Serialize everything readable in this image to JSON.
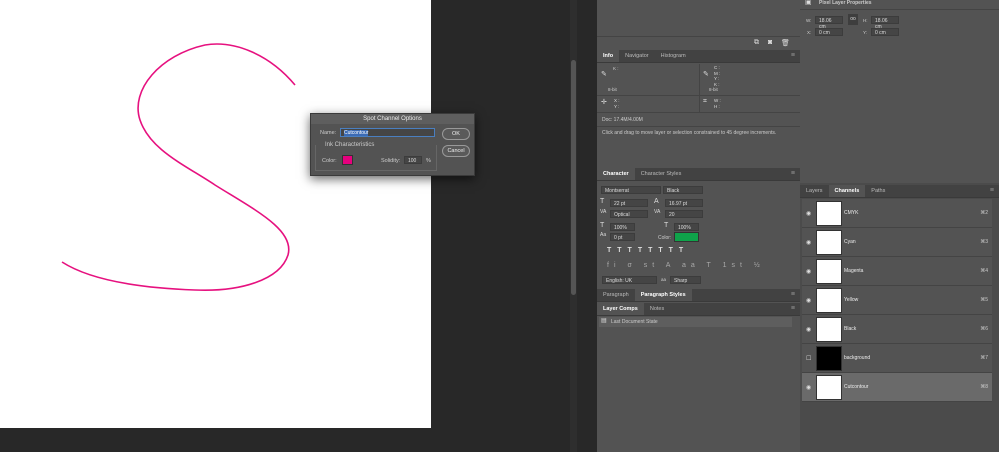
{
  "canvas": {
    "stroke_color": "#e6117f"
  },
  "dialog": {
    "title": "Spot Channel Options",
    "name_label": "Name:",
    "name_value": "Cutcontour",
    "ok": "OK",
    "cancel": "Cancel",
    "ink_label": "Ink Characteristics",
    "color_label": "Color:",
    "color": "#e6007e",
    "solidity_label": "Solidity:",
    "solidity_value": "100",
    "percent": "%"
  },
  "info": {
    "tabs": [
      "Info",
      "Navigator",
      "Histogram"
    ],
    "k": "K :",
    "cmyk": [
      "C :",
      "M :",
      "Y :",
      "K :"
    ],
    "bit1": "8-bit",
    "bit2": "8-bit",
    "xy": [
      "X :",
      "Y :"
    ],
    "wh": [
      "W :",
      "H :"
    ],
    "doc": "Doc: 17.4M/4.00M",
    "hint": "Click and drag to move layer or selection constrained to 45 degree increments."
  },
  "character": {
    "tabs": [
      "Character",
      "Character Styles"
    ],
    "font": "Montserrat",
    "style": "Black",
    "size": "22 pt",
    "leading": "16.97 pt",
    "kerning": "Optical",
    "tracking": "20",
    "vscale": "100%",
    "hscale": "100%",
    "baseline": "0 pt",
    "color_label": "Color:",
    "color": "#0fa34a",
    "language": "English: UK",
    "aa_label": "aa",
    "antialias": "Sharp"
  },
  "paragraph": {
    "tabs": [
      "Paragraph",
      "Paragraph Styles"
    ]
  },
  "layercomps": {
    "tabs": [
      "Layer Comps",
      "Notes"
    ],
    "item": "Last Document State"
  },
  "properties": {
    "title": "Pixel Layer Properties",
    "w_label": "W:",
    "w": "18.06 cm",
    "h_label": "H:",
    "h": "18.06 cm",
    "x_label": "X:",
    "x": "0 cm",
    "y_label": "Y:",
    "y": "0 cm",
    "link": "oo"
  },
  "channels": {
    "tabs": [
      "Layers",
      "Channels",
      "Paths"
    ],
    "items": [
      {
        "name": "CMYK",
        "shortcut": "⌘2",
        "visible": true,
        "thumb": "#ffffff"
      },
      {
        "name": "Cyan",
        "shortcut": "⌘3",
        "visible": true,
        "thumb": "#ffffff"
      },
      {
        "name": "Magenta",
        "shortcut": "⌘4",
        "visible": true,
        "thumb": "#ffffff"
      },
      {
        "name": "Yellow",
        "shortcut": "⌘5",
        "visible": true,
        "thumb": "#ffffff"
      },
      {
        "name": "Black",
        "shortcut": "⌘6",
        "visible": true,
        "thumb": "#ffffff"
      },
      {
        "name": "background",
        "shortcut": "⌘7",
        "visible": false,
        "thumb": "#000000"
      },
      {
        "name": "Cutcontour",
        "shortcut": "⌘8",
        "visible": true,
        "thumb": "#ffffff",
        "selected": true
      }
    ]
  }
}
